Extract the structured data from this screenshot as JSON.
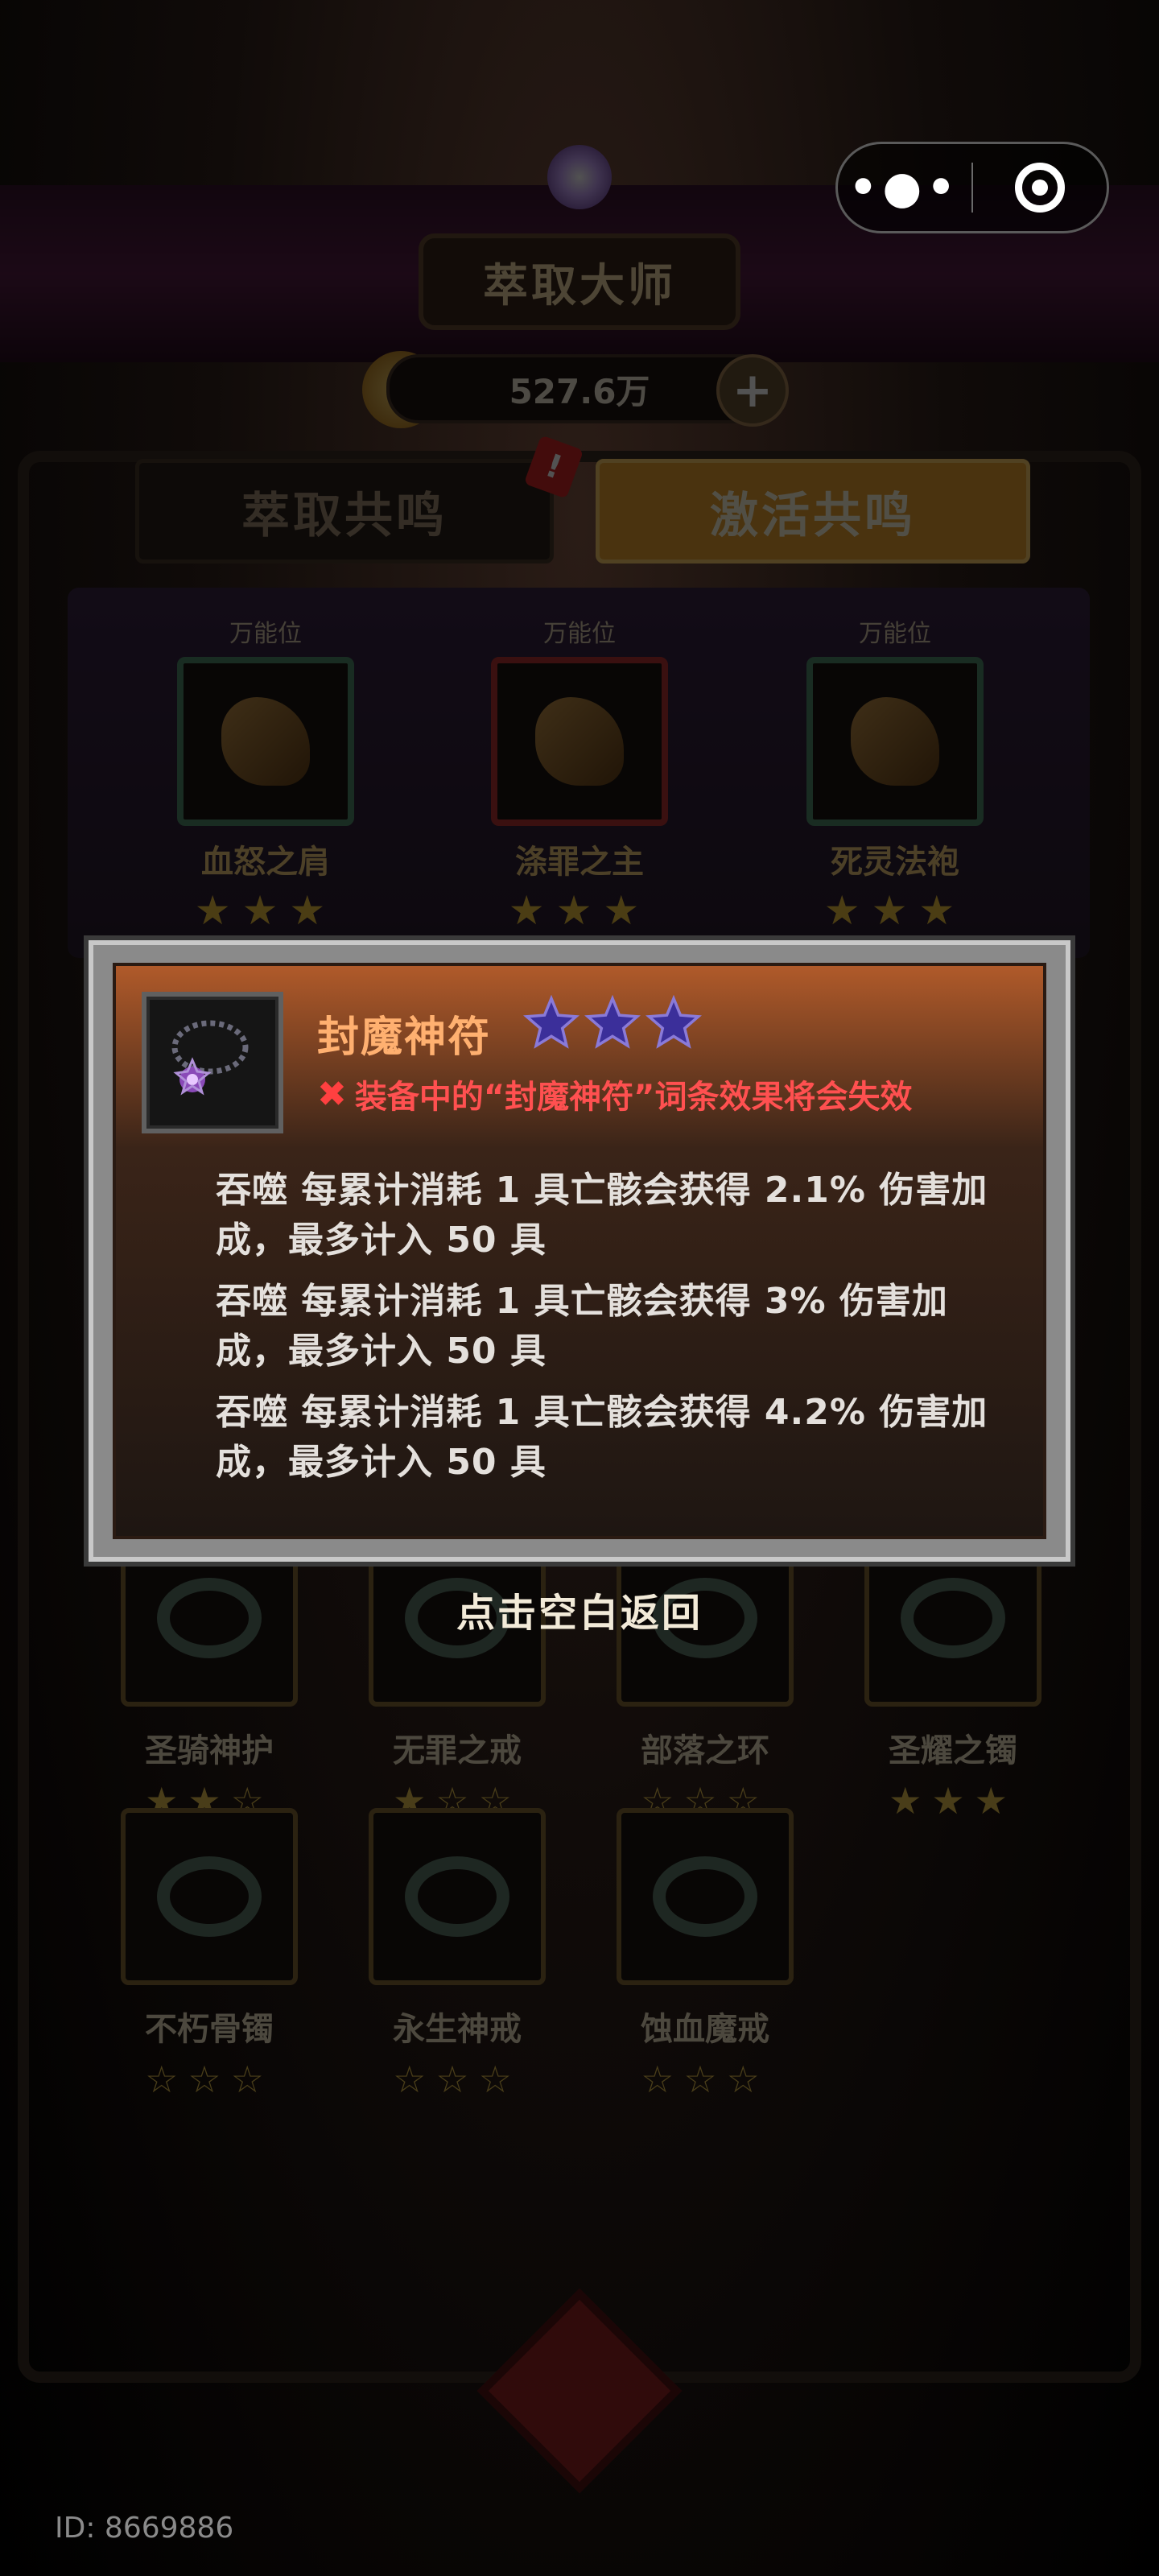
{
  "capsule": {
    "more_icon": "ellipsis-icon",
    "close_icon": "target-circle-icon"
  },
  "header": {
    "title": "萃取大师",
    "currency_value": "527.6万",
    "currency_icon": "gold-coin-icon",
    "add_icon": "plus-icon"
  },
  "tabs": [
    {
      "label": "萃取共鸣",
      "active": false
    },
    {
      "label": "激活共鸣",
      "active": true
    }
  ],
  "notification_badge": "!",
  "slots": [
    {
      "tag": "万能位",
      "name": "血怒之肩",
      "stars": 3
    },
    {
      "tag": "万能位",
      "name": "涤罪之主",
      "stars": 3
    },
    {
      "tag": "万能位",
      "name": "死灵法袍",
      "stars": 3
    }
  ],
  "grid_items": [
    {
      "name": "圣骑神护",
      "stars": "★★☆"
    },
    {
      "name": "无罪之戒",
      "stars": "★☆☆"
    },
    {
      "name": "部落之环",
      "stars": "☆☆☆"
    },
    {
      "name": "圣耀之镯",
      "stars": "★★★"
    },
    {
      "name": "不朽骨镯",
      "stars": "☆☆☆"
    },
    {
      "name": "永生神戒",
      "stars": "☆☆☆"
    },
    {
      "name": "蚀血魔戒",
      "stars": "☆☆☆"
    }
  ],
  "modal": {
    "item_name": "封魔神符",
    "item_stars": 3,
    "item_icon": "amulet-icon",
    "warning": "装备中的“封魔神符”词条效果将会失效",
    "effects": [
      "吞噬 每累计消耗 1 具亡骸会获得 2.1% 伤害加成，最多计入 50 具",
      "吞噬 每累计消耗 1 具亡骸会获得 3% 伤害加成，最多计入 50 具",
      "吞噬 每累计消耗 1 具亡骸会获得 4.2% 伤害加成，最多计入 50 具"
    ]
  },
  "dismiss_hint": "点击空白返回",
  "user_id": "ID: 8669886",
  "colors": {
    "accent_orange": "#f0a020",
    "title_orange": "#ffb070",
    "warning_red": "#ff5050",
    "star_purple": "#4a3ab0"
  }
}
